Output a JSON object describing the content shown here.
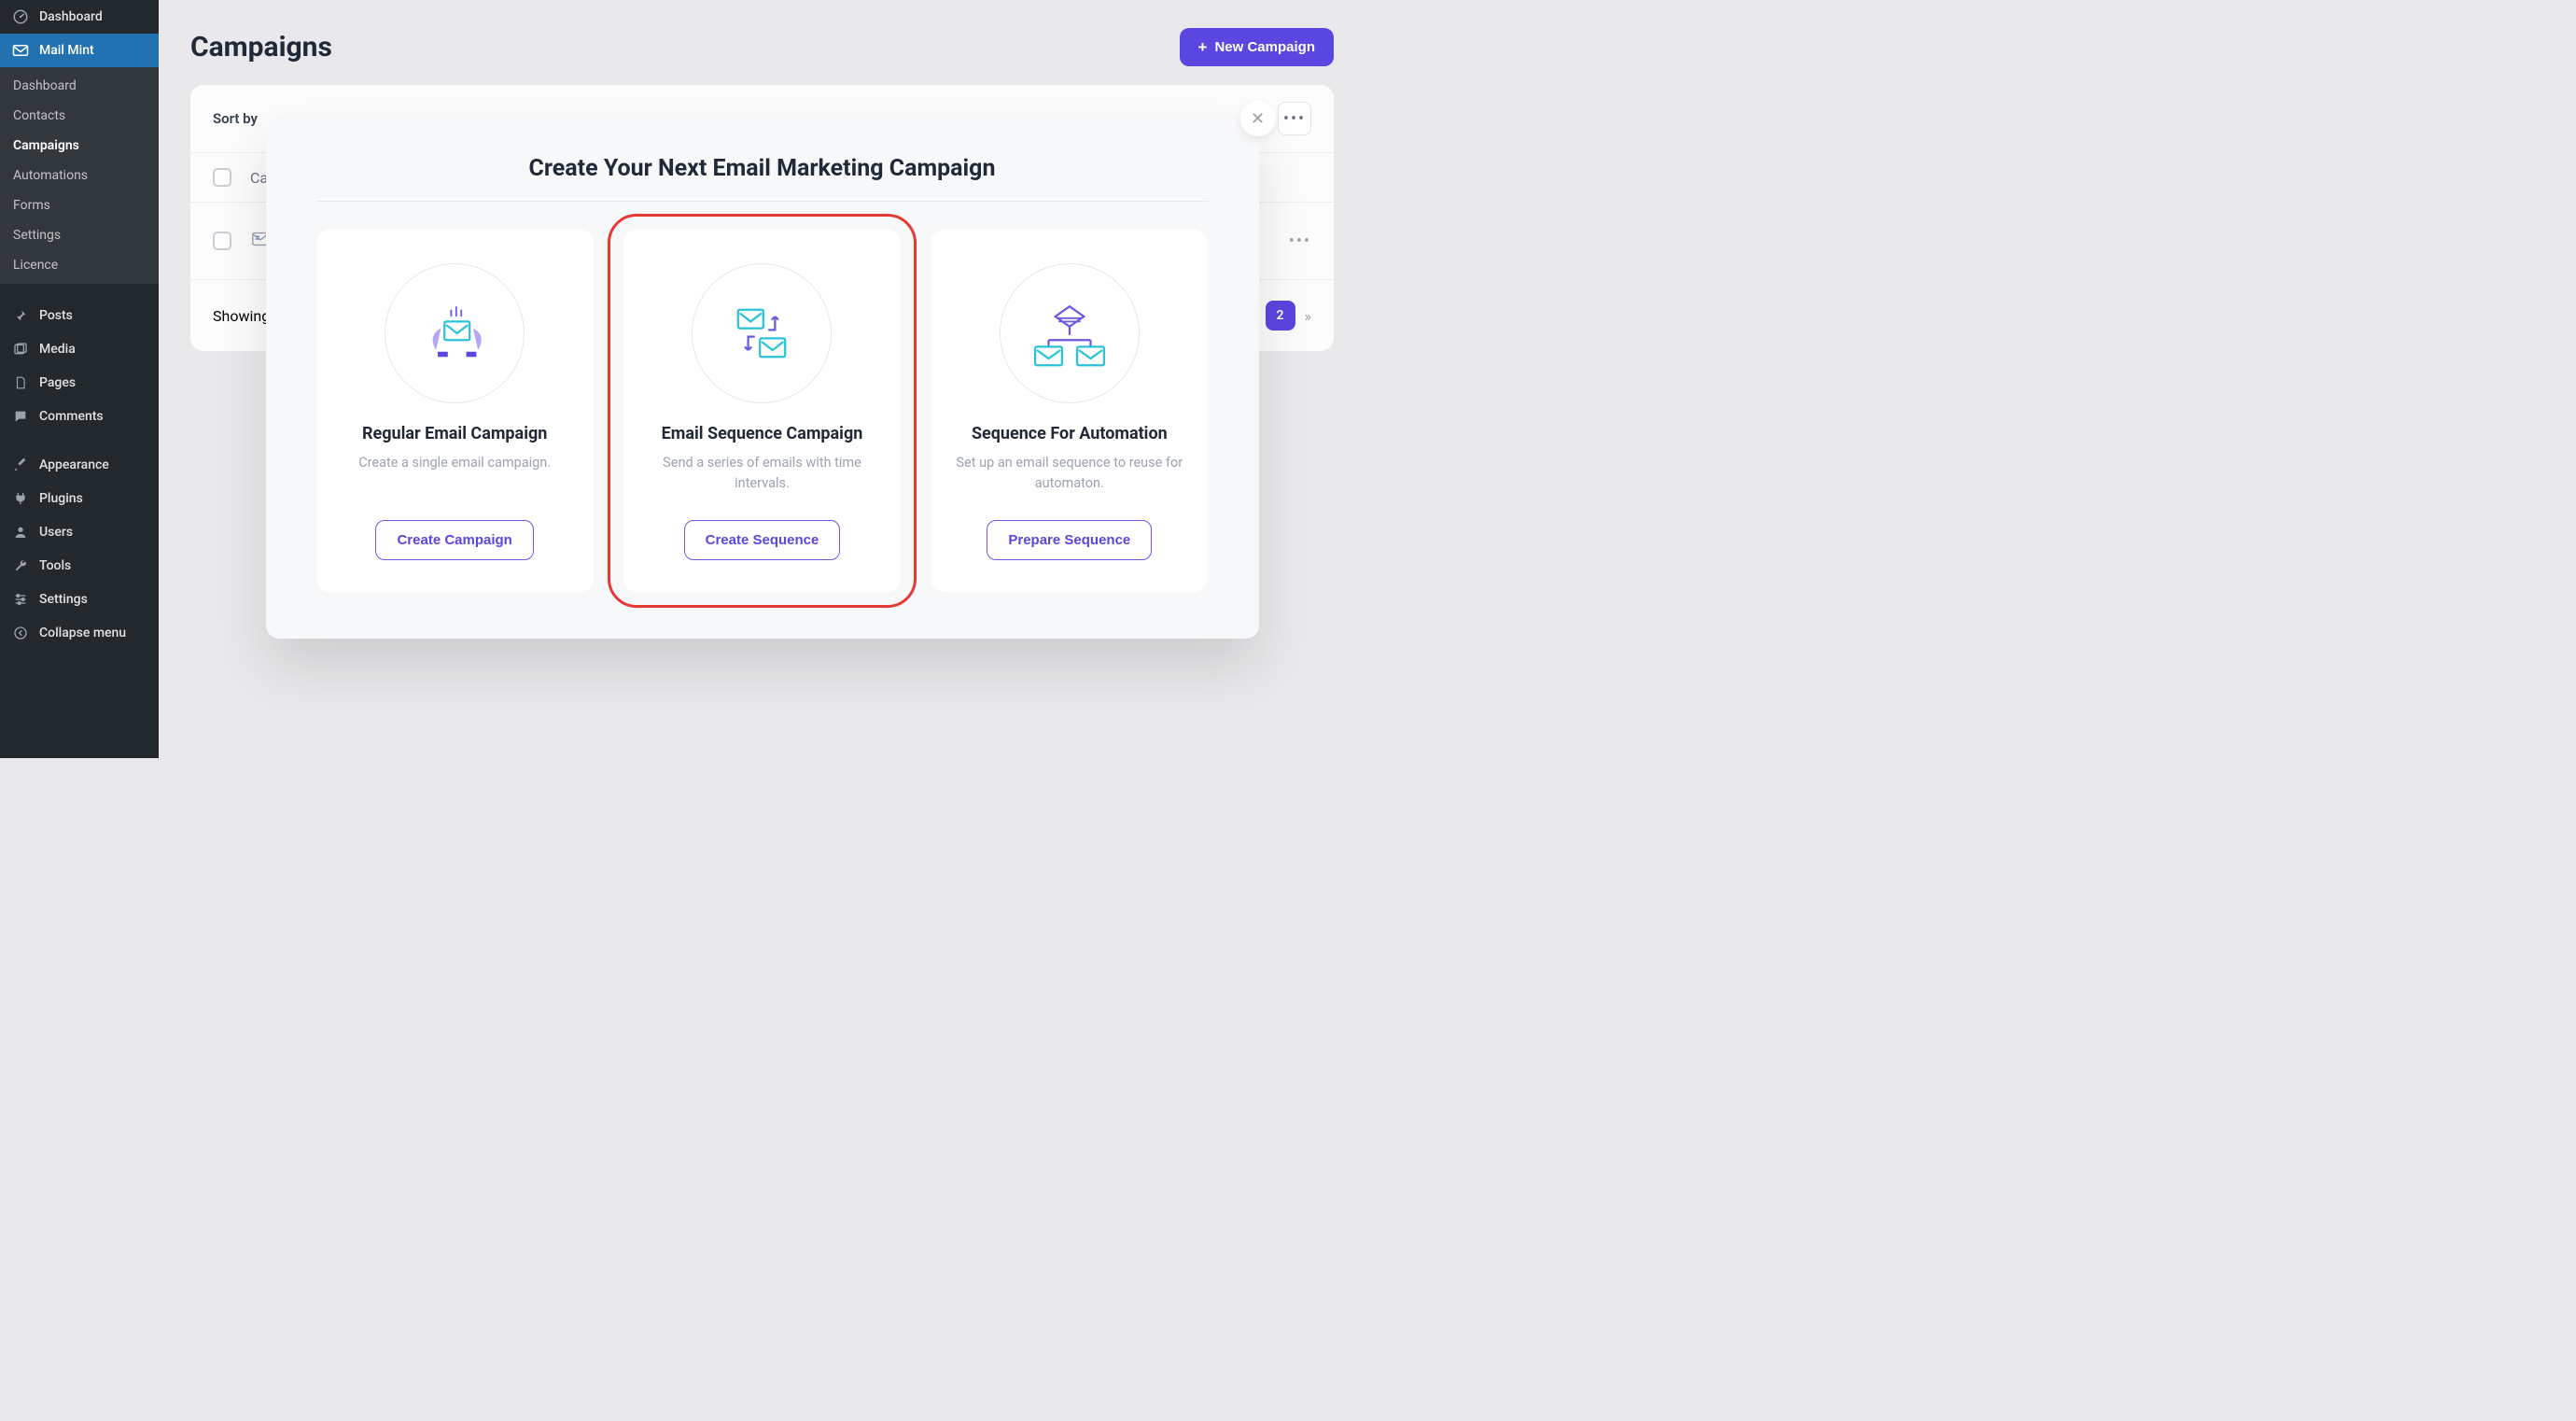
{
  "sidebar": {
    "dashboard": {
      "label": "Dashboard",
      "icon": "dashboard-icon"
    },
    "mailmint": {
      "label": "Mail Mint",
      "icon": "mail-icon",
      "active": true
    },
    "sub": [
      {
        "label": "Dashboard"
      },
      {
        "label": "Contacts"
      },
      {
        "label": "Campaigns",
        "active": true
      },
      {
        "label": "Automations"
      },
      {
        "label": "Forms"
      },
      {
        "label": "Settings"
      },
      {
        "label": "Licence"
      }
    ],
    "wp": [
      {
        "label": "Posts",
        "icon": "pin-icon"
      },
      {
        "label": "Media",
        "icon": "media-icon"
      },
      {
        "label": "Pages",
        "icon": "page-icon"
      },
      {
        "label": "Comments",
        "icon": "comment-icon"
      },
      {
        "label": "Appearance",
        "icon": "brush-icon"
      },
      {
        "label": "Plugins",
        "icon": "plug-icon"
      },
      {
        "label": "Users",
        "icon": "user-icon"
      },
      {
        "label": "Tools",
        "icon": "wrench-icon"
      },
      {
        "label": "Settings",
        "icon": "sliders-icon"
      },
      {
        "label": "Collapse menu",
        "icon": "collapse-icon"
      }
    ]
  },
  "header": {
    "title": "Campaigns",
    "new_button": "New Campaign"
  },
  "list": {
    "sort_label": "Sort by",
    "col_title": "Ca",
    "showing_prefix": "Showing",
    "page_current": "2"
  },
  "modal": {
    "title": "Create Your Next Email Marketing Campaign",
    "close_aria": "Close",
    "options": [
      {
        "title": "Regular Email Campaign",
        "desc": "Create a single email campaign.",
        "button": "Create Campaign"
      },
      {
        "title": "Email Sequence Campaign",
        "desc": "Send a series of emails with time intervals.",
        "button": "Create Sequence",
        "highlight": true
      },
      {
        "title": "Sequence For Automation",
        "desc": "Set up an email sequence to reuse for automaton.",
        "button": "Prepare Sequence"
      }
    ]
  }
}
